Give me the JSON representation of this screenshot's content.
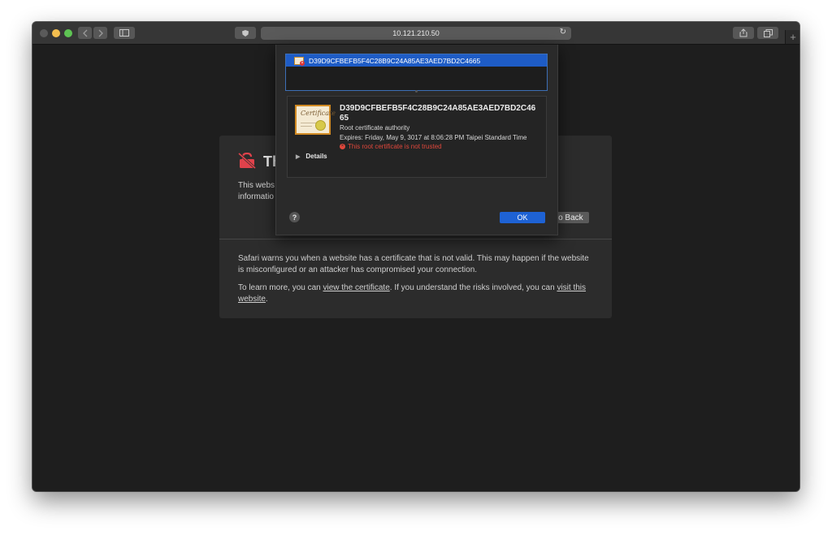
{
  "toolbar": {
    "address": "10.121.210.50",
    "reload_icon": "reload-icon",
    "new_tab_symbol": "+"
  },
  "warning": {
    "title_fragment": "Th",
    "body_fragment_line1": "This webs",
    "body_fragment_line2": "informatio",
    "go_back": "Go Back",
    "para1": "Safari warns you when a website has a certificate that is not valid. This may happen if the website is misconfigured or an attacker has compromised your connection.",
    "para2_before": "To learn more, you can ",
    "para2_link1": "view the certificate",
    "para2_middle": ". If you understand the risks involved, you can ",
    "para2_link2": "visit this website",
    "para2_after": "."
  },
  "cert_sheet": {
    "chain_item": "D39D9CFBEFB5F4C28B9C24A85AE3AED7BD2C4665",
    "icon_text": "Certificate",
    "name": "D39D9CFBEFB5F4C28B9C24A85AE3AED7BD2C4665",
    "type": "Root certificate authority",
    "expires": "Expires: Friday, May 9, 3017 at 8:06:28 PM Taipei Standard Time",
    "error": "This root certificate is not trusted",
    "details_label": "Details",
    "help_label": "?",
    "ok_label": "OK"
  },
  "colors": {
    "accent": "#1e62d4",
    "error": "#e0473b",
    "window_bg": "#1e1e1e"
  }
}
